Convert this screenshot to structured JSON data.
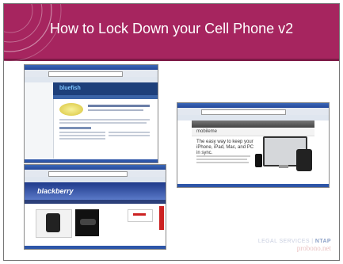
{
  "slide": {
    "title": "How to Lock Down your Cell Phone v2"
  },
  "screenshots": [
    {
      "site": "bluefish",
      "status": ""
    },
    {
      "site": "mobileme",
      "headline": "The easy way to keep your iPhone, iPad, Mac, and PC in sync."
    },
    {
      "site": "blackberry",
      "label": "blackberry"
    }
  ],
  "footer": {
    "org_left": "LEGAL SERVICES | ",
    "org_right": "NTAP",
    "site": "probono.net"
  },
  "colors": {
    "title_band": "#a6255f",
    "accent_blue": "#2e56a8"
  }
}
